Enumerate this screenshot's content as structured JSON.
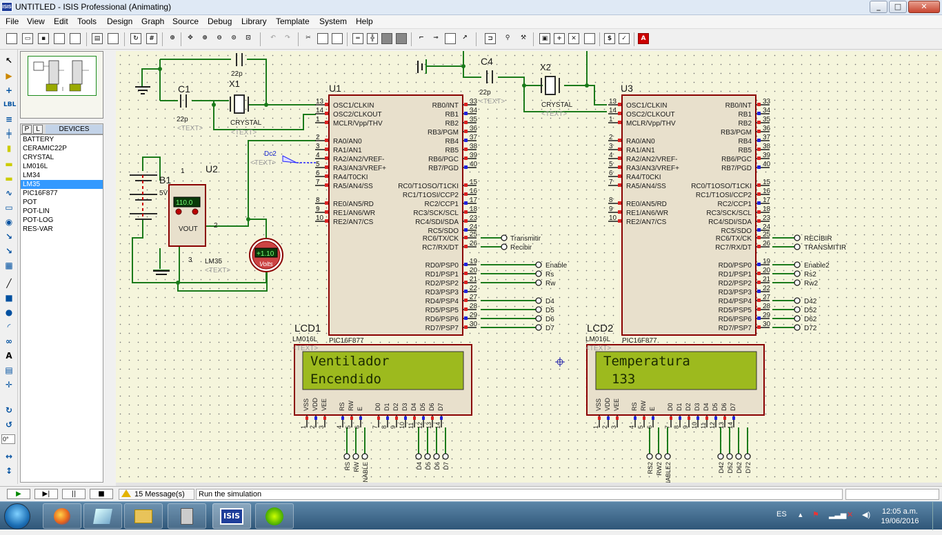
{
  "window": {
    "title": "UNTITLED - ISIS Professional (Animating)",
    "app_icon": "ISIS",
    "min": "_",
    "max": "□",
    "close": "✕"
  },
  "menu": [
    "File",
    "View",
    "Edit",
    "Tools",
    "Design",
    "Graph",
    "Source",
    "Debug",
    "Library",
    "Template",
    "System",
    "Help"
  ],
  "panel": {
    "tab_p": "P",
    "tab_l": "L",
    "title": "DEVICES",
    "angle": "0°"
  },
  "devices": [
    "BATTERY",
    "CERAMIC22P",
    "CRYSTAL",
    "LM016L",
    "LM34",
    "LM35",
    "PIC16F877",
    "POT",
    "POT-LIN",
    "POT-LOG",
    "RES-VAR"
  ],
  "selected_device": "LM35",
  "schematic": {
    "u1": {
      "ref": "U1",
      "part": "PIC16F877",
      "left_labels": [
        "OSC1/CLKIN",
        "OSC2/CLKOUT",
        "MCLR/Vpp/THV",
        "RA0/AN0",
        "RA1/AN1",
        "RA2/AN2/VREF-",
        "RA3/AN3/VREF+",
        "RA4/T0CKI",
        "RA5/AN4/SS",
        "RE0/AN5/RD",
        "RE1/AN6/WR",
        "RE2/AN7/CS"
      ],
      "left_pins": [
        "13",
        "14",
        "1",
        "2",
        "3",
        "4",
        "5",
        "6",
        "7",
        "8",
        "9",
        "10"
      ],
      "right_labels": [
        "RB0/INT",
        "RB1",
        "RB2",
        "RB3/PGM",
        "RB4",
        "RB5",
        "RB6/PGC",
        "RB7/PGD",
        "RC0/T1OSO/T1CKI",
        "RC1/T1OSI/CCP2",
        "RC2/CCP1",
        "RC3/SCK/SCL",
        "RC4/SDI/SDA",
        "RC5/SDO",
        "RC6/TX/CK",
        "RC7/RX/DT",
        "RD0/PSP0",
        "RD1/PSP1",
        "RD2/PSP2",
        "RD3/PSP3",
        "RD4/PSP4",
        "RD5/PSP5",
        "RD6/PSP6",
        "RD7/PSP7"
      ],
      "right_pins": [
        "33",
        "34",
        "35",
        "36",
        "37",
        "38",
        "39",
        "40",
        "15",
        "16",
        "17",
        "18",
        "23",
        "24",
        "25",
        "26",
        "19",
        "20",
        "21",
        "22",
        "27",
        "28",
        "29",
        "30"
      ],
      "uart_terms": [
        "Transmitir",
        "Recibir"
      ],
      "port_d_terms": [
        "Enable",
        "Rs",
        "Rw",
        "",
        "D4",
        "D5",
        "D6",
        "D7"
      ]
    },
    "u3": {
      "ref": "U3",
      "part": "PIC16F877",
      "uart_terms": [
        "RECIBIR",
        "TRANSMITIR"
      ],
      "port_d_terms": [
        "Enable2",
        "Rs2",
        "Rw2",
        "",
        "D42",
        "D52",
        "D62",
        "D72"
      ]
    },
    "c1": {
      "ref": "C1",
      "value": "22p"
    },
    "c_top": {
      "value": "22p"
    },
    "c4": {
      "ref": "C4",
      "value": "22p"
    },
    "crystal_u1": {
      "ref": "X1",
      "part": "CRYSTAL"
    },
    "crystal_u3": {
      "ref": "X2",
      "part": "CRYSTAL"
    },
    "text_tag": "<TEXT>",
    "battery": {
      "ref": "B1",
      "value": "5V"
    },
    "u2": {
      "ref": "U2",
      "part": "LM35",
      "reading": "110.0",
      "pin_vout": "VOUT",
      "pins": [
        "1",
        "2",
        "3"
      ]
    },
    "voltmeter": {
      "reading": "+1.10",
      "unit": "Volts"
    },
    "probe": {
      "label": "Dc2"
    },
    "lcd1": {
      "ref": "LCD1",
      "part": "LM016L",
      "line1": "Ventilador",
      "line2": "Encendido",
      "pin_names": [
        "VSS",
        "VDD",
        "VEE",
        "RS",
        "RW",
        "E",
        "D0",
        "D1",
        "D2",
        "D3",
        "D4",
        "D5",
        "D6",
        "D7"
      ],
      "pin_numbers": [
        "1",
        "2",
        "3",
        "4",
        "5",
        "6",
        "7",
        "8",
        "9",
        "10",
        "11",
        "12",
        "13",
        "14"
      ],
      "bottom_terms": [
        "RS",
        "RW",
        "ENABLE",
        "D4",
        "D5",
        "D6",
        "D7"
      ]
    },
    "lcd2": {
      "ref": "LCD2",
      "part": "LM016L",
      "line1": "Temperatura",
      "line2": "133",
      "bottom_terms": [
        "RS2",
        "RW2",
        "ENABLE2",
        "D42",
        "D52",
        "D62",
        "D72"
      ]
    }
  },
  "status": {
    "messages": "15 Message(s)",
    "text": "Run the simulation"
  },
  "sim_buttons": [
    "▶",
    "▶|",
    "||",
    "■"
  ],
  "taskbar": {
    "apps": [
      "firefox",
      "explorer",
      "files",
      "calculator",
      "isis",
      "ares"
    ],
    "isis_label": "ISIS",
    "lang": "ES",
    "time": "12:05 a.m.",
    "date": "19/06/2016"
  }
}
